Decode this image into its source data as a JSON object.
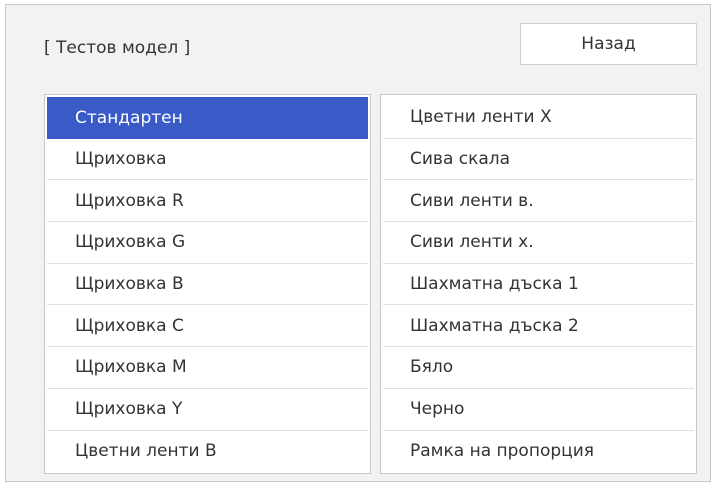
{
  "dialog": {
    "title": "[ Тестов модел ]",
    "back_label": "Назад"
  },
  "left_list": {
    "items": [
      {
        "label": "Стандартен",
        "selected": true
      },
      {
        "label": "Щриховка",
        "selected": false
      },
      {
        "label": "Щриховка R",
        "selected": false
      },
      {
        "label": "Щриховка G",
        "selected": false
      },
      {
        "label": "Щриховка B",
        "selected": false
      },
      {
        "label": "Щриховка C",
        "selected": false
      },
      {
        "label": "Щриховка M",
        "selected": false
      },
      {
        "label": "Щриховка Y",
        "selected": false
      },
      {
        "label": "Цветни ленти В",
        "selected": false
      }
    ]
  },
  "right_list": {
    "items": [
      {
        "label": "Цветни ленти Х",
        "selected": false
      },
      {
        "label": "Сива скала",
        "selected": false
      },
      {
        "label": "Сиви ленти в.",
        "selected": false
      },
      {
        "label": "Сиви ленти х.",
        "selected": false
      },
      {
        "label": "Шахматна дъска 1",
        "selected": false
      },
      {
        "label": "Шахматна дъска 2",
        "selected": false
      },
      {
        "label": "Бяло",
        "selected": false
      },
      {
        "label": "Черно",
        "selected": false
      },
      {
        "label": "Рамка на пропорция",
        "selected": false
      }
    ]
  },
  "colors": {
    "selection": "#3a5ac8",
    "panel_background": "#f2f2f2"
  }
}
